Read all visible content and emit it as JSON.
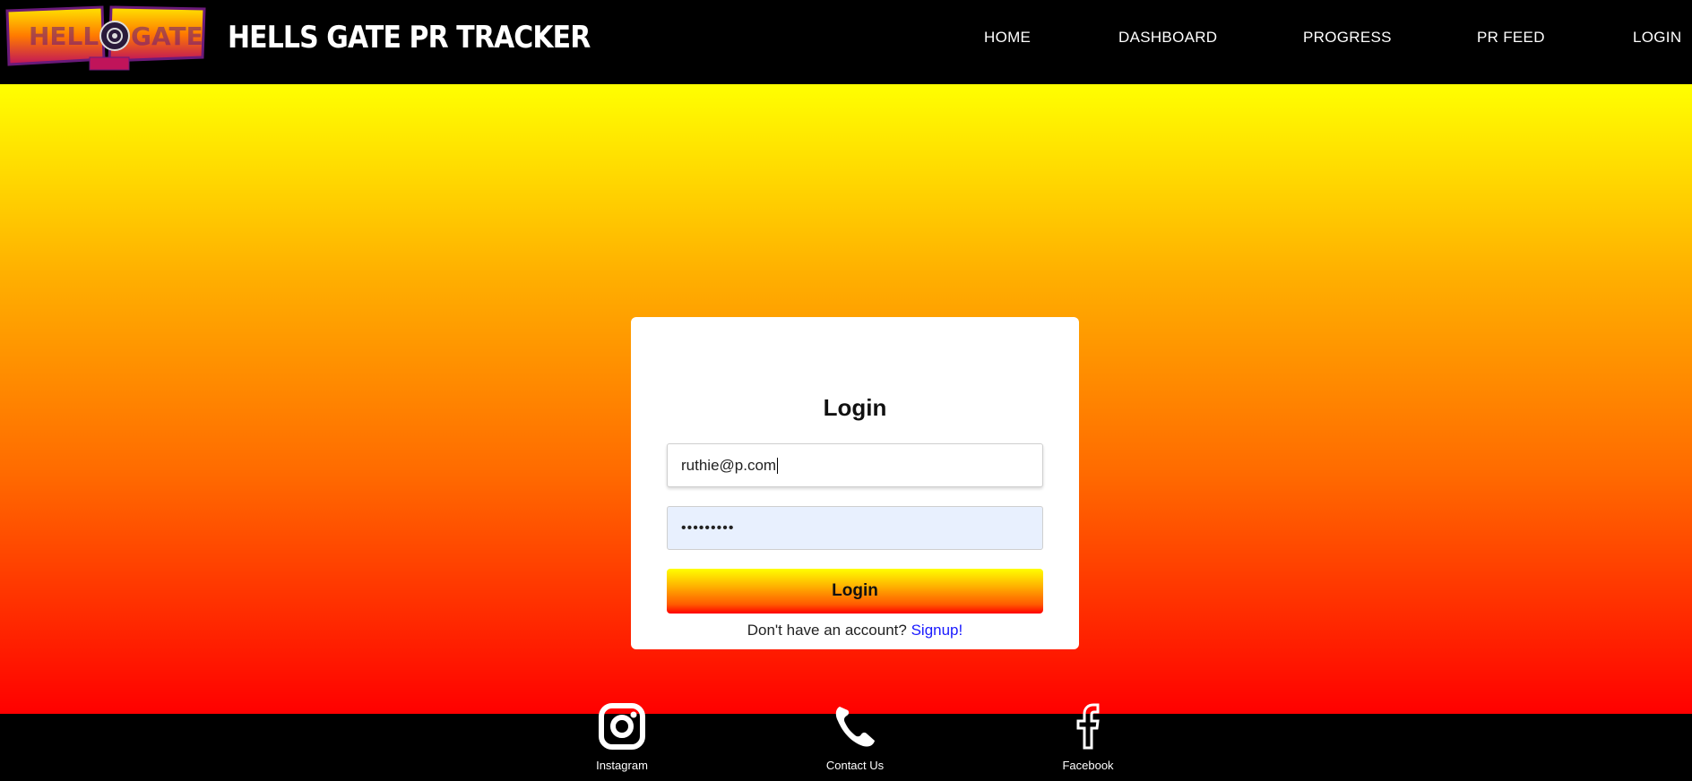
{
  "header": {
    "logo_text": "HELLS GATE",
    "brand": "HELLS GATE PR TRACKER",
    "nav": [
      "HOME",
      "DASHBOARD",
      "PROGRESS",
      "PR FEED",
      "LOGIN"
    ]
  },
  "login": {
    "title": "Login",
    "email_value": "ruthie@p.com",
    "password_mask": "•••••••••",
    "button_label": "Login",
    "signup_prompt": "Don't have an account?",
    "signup_link": "Signup!"
  },
  "footer": {
    "items": [
      {
        "label": "Instagram",
        "icon": "instagram-icon"
      },
      {
        "label": "Contact Us",
        "icon": "phone-icon"
      },
      {
        "label": "Facebook",
        "icon": "facebook-icon"
      }
    ]
  },
  "colors": {
    "gradient_top": "#ffff00",
    "gradient_bottom": "#ff0000",
    "link": "#1a1aff",
    "autofill": "#e8f0fe"
  }
}
